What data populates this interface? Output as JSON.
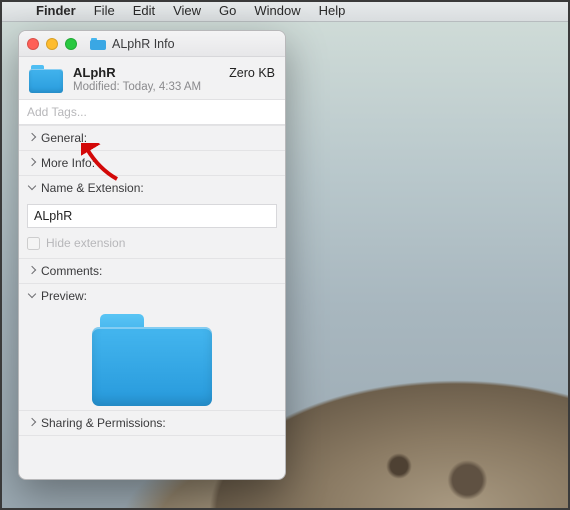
{
  "menubar": {
    "app": "Finder",
    "items": [
      "File",
      "Edit",
      "View",
      "Go",
      "Window",
      "Help"
    ]
  },
  "window": {
    "title": "ALphR Info",
    "header": {
      "name": "ALphR",
      "size": "Zero KB",
      "modified": "Modified: Today, 4:33 AM"
    },
    "tags_placeholder": "Add Tags...",
    "sections": {
      "general": "General:",
      "more_info": "More Info:",
      "name_ext": "Name & Extension:",
      "comments": "Comments:",
      "preview": "Preview:",
      "sharing": "Sharing & Permissions:"
    },
    "name_ext": {
      "value": "ALphR",
      "hide_extension_label": "Hide extension",
      "hide_extension_checked": false
    }
  }
}
